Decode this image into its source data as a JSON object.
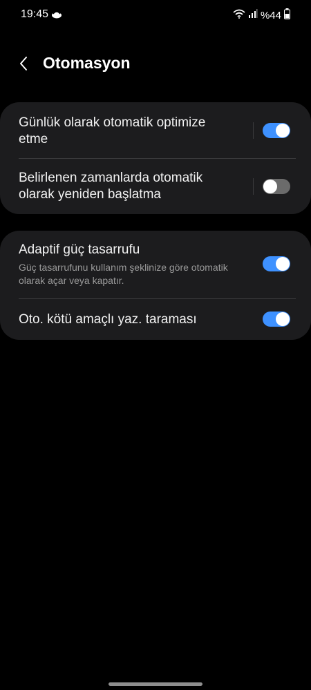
{
  "status_bar": {
    "time": "19:45",
    "battery_text": "%44",
    "icons": [
      "notification-icon",
      "wifi-icon",
      "signal-icon",
      "battery-icon"
    ]
  },
  "header": {
    "title": "Otomasyon",
    "back_icon": "back-chevron-icon"
  },
  "groups": [
    {
      "items": [
        {
          "title": "Günlük olarak otomatik optimize etme",
          "toggle": "on"
        },
        {
          "title": "Belirlenen zamanlarda otomatik olarak yeniden başlatma",
          "toggle": "off"
        }
      ]
    },
    {
      "items": [
        {
          "title": "Adaptif güç tasarrufu",
          "subtitle": "Güç tasarrufunu kullanım şeklinize göre otomatik olarak açar veya kapatır.",
          "toggle": "on"
        },
        {
          "title": "Oto. kötü amaçlı yaz. taraması",
          "toggle": "on"
        }
      ]
    }
  ],
  "colors": {
    "background": "#000000",
    "card": "#1c1c1e",
    "toggle_on": "#3e91ff",
    "toggle_off": "#6b6b6b"
  }
}
